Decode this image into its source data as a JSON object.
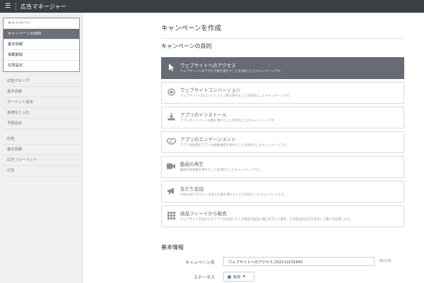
{
  "app": {
    "title": "広告マネージャー"
  },
  "sidebar": {
    "campaign_group": [
      {
        "label": "キャンペーン",
        "selected": false
      },
      {
        "label": "キャンペーンの目的",
        "selected": true
      },
      {
        "label": "基本情報",
        "selected": false
      },
      {
        "label": "掲載期間",
        "selected": false
      },
      {
        "label": "任意設定",
        "selected": false
      }
    ],
    "adgroup_group": [
      {
        "label": "広告グループ"
      },
      {
        "label": "基本情報"
      },
      {
        "label": "ターゲット設定"
      },
      {
        "label": "最適化と入札"
      },
      {
        "label": "予算設定"
      }
    ],
    "ad_group": [
      {
        "label": "広告"
      },
      {
        "label": "基本情報"
      },
      {
        "label": "広告フォーマット"
      },
      {
        "label": "広告"
      }
    ]
  },
  "main": {
    "page_title": "キャンペーンを作成",
    "objective_title": "キャンペーンの目的",
    "objectives": [
      {
        "icon": "cursor-icon",
        "title": "ウェブサイトへのアクセス",
        "desc": "ウェブサイトへのアクセス数を増やすことを目的としたキャンペーンです。",
        "selected": true
      },
      {
        "icon": "target-icon",
        "title": "ウェブサイトコンバージョン",
        "desc": "ウェブサイトでのコンバージョン数を増やすことを目的としたキャンペーンです。",
        "selected": false
      },
      {
        "icon": "download-icon",
        "title": "アプリのインストール",
        "desc": "アプリのインストール数を増やすことを目的としたキャンペーンです。",
        "selected": false
      },
      {
        "icon": "handshake-icon",
        "title": "アプリのエンゲージメント",
        "desc": "アプリ利用者のアプリの起動頻度を増やすことを目的としたキャンペーンです。",
        "selected": false
      },
      {
        "icon": "video-icon",
        "title": "動画の再生",
        "desc": "動画の再生数を増やすことを目的としたキャンペーンです。",
        "selected": false
      },
      {
        "icon": "megaphone-icon",
        "title": "友だち追加",
        "desc": "LINE公式アカウントの友だち数を増やすことを目的としたキャンペーンです。",
        "selected": false
      },
      {
        "icon": "grid-icon",
        "title": "商品フィードから販売",
        "desc": "ウェブサイトを訪れたかアプリを利用した人が特定の商品に関心を示した場合、その商品の広告を表示して購入を促進します。",
        "selected": false
      }
    ],
    "basic_info_title": "基本情報",
    "campaign_name_label": "キャンペーン名",
    "campaign_name_value": "ウェブサイトへのアクセス 202112231645",
    "campaign_name_counter": "26/120",
    "status_label": "ステータス",
    "status_value": "有効",
    "colors": {
      "topbar": "#3b3e44",
      "selected": "#676b73",
      "status_dot": "#2e86de"
    }
  }
}
